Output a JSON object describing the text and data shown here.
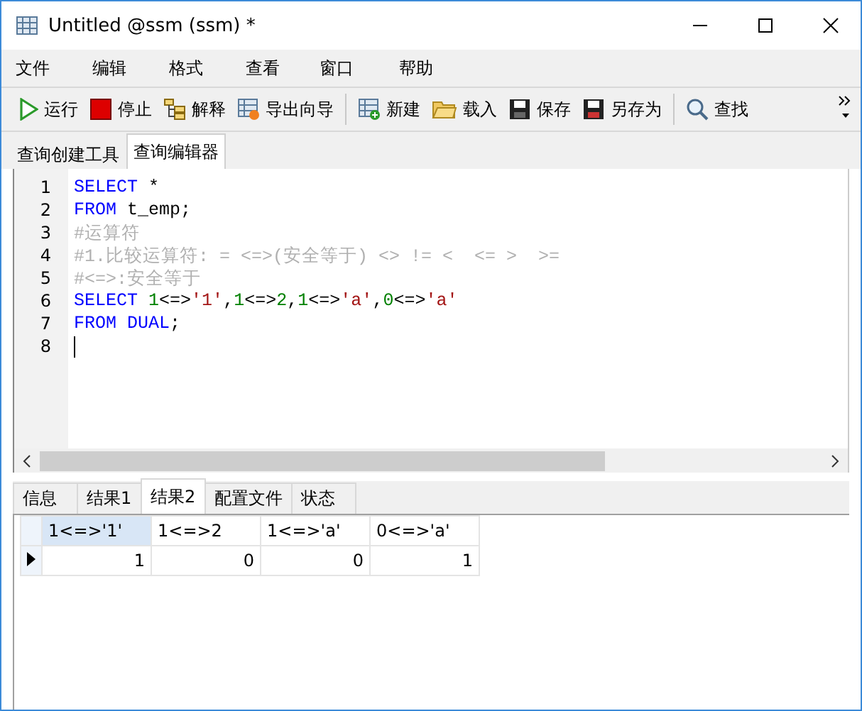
{
  "window": {
    "title": "Untitled @ssm (ssm) *"
  },
  "menu": [
    "文件",
    "编辑",
    "格式",
    "查看",
    "窗口",
    "帮助"
  ],
  "toolbar": [
    {
      "kind": "run",
      "label": "运行"
    },
    {
      "kind": "stop",
      "label": "停止"
    },
    {
      "kind": "explain",
      "label": "解释"
    },
    {
      "kind": "export",
      "label": "导出向导"
    },
    {
      "kind": "sep"
    },
    {
      "kind": "new",
      "label": "新建"
    },
    {
      "kind": "load",
      "label": "载入"
    },
    {
      "kind": "save",
      "label": "保存"
    },
    {
      "kind": "saveas",
      "label": "另存为"
    },
    {
      "kind": "sep"
    },
    {
      "kind": "find",
      "label": "查找"
    }
  ],
  "tabs": [
    {
      "label": "查询创建工具",
      "selected": false
    },
    {
      "label": "查询编辑器",
      "selected": true
    }
  ],
  "editor": {
    "lines": [
      {
        "number": "1",
        "tokens": [
          {
            "kind": "keyword",
            "text": "SELECT"
          },
          {
            "kind": "plain",
            "text": " *"
          }
        ]
      },
      {
        "number": "2",
        "tokens": [
          {
            "kind": "keyword",
            "text": "FROM"
          },
          {
            "kind": "plain",
            "text": " t_emp;"
          }
        ]
      },
      {
        "number": "3",
        "tokens": [
          {
            "kind": "comment",
            "text": "#运算符"
          }
        ]
      },
      {
        "number": "4",
        "tokens": [
          {
            "kind": "comment",
            "text": "#1.比较运算符: = <=>(安全等于) <> != <  <= >  >="
          }
        ]
      },
      {
        "number": "5",
        "tokens": [
          {
            "kind": "comment",
            "text": "#<=>:安全等于"
          }
        ]
      },
      {
        "number": "6",
        "tokens": [
          {
            "kind": "keyword",
            "text": "SELECT "
          },
          {
            "kind": "number",
            "text": "1"
          },
          {
            "kind": "plain",
            "text": "<=>"
          },
          {
            "kind": "string",
            "text": "'1'"
          },
          {
            "kind": "plain",
            "text": ","
          },
          {
            "kind": "number",
            "text": "1"
          },
          {
            "kind": "plain",
            "text": "<=>"
          },
          {
            "kind": "number",
            "text": "2"
          },
          {
            "kind": "plain",
            "text": ","
          },
          {
            "kind": "number",
            "text": "1"
          },
          {
            "kind": "plain",
            "text": "<=>"
          },
          {
            "kind": "string",
            "text": "'a'"
          },
          {
            "kind": "plain",
            "text": ","
          },
          {
            "kind": "number",
            "text": "0"
          },
          {
            "kind": "plain",
            "text": "<=>"
          },
          {
            "kind": "string",
            "text": "'a'"
          }
        ]
      },
      {
        "number": "7",
        "tokens": [
          {
            "kind": "keyword",
            "text": "FROM DUAL"
          },
          {
            "kind": "plain",
            "text": ";"
          }
        ]
      },
      {
        "number": "8",
        "cursor": true
      }
    ]
  },
  "result_tabs": [
    {
      "label": "信息",
      "selected": false
    },
    {
      "label": "结果1",
      "selected": false
    },
    {
      "label": "结果2",
      "selected": true
    },
    {
      "label": "配置文件",
      "selected": false
    },
    {
      "label": "状态",
      "selected": false
    }
  ],
  "table": {
    "columns": [
      {
        "label": "1<=>'1'",
        "selected": true
      },
      {
        "label": "1<=>2",
        "selected": false
      },
      {
        "label": "1<=>'a'",
        "selected": false
      },
      {
        "label": "0<=>'a'",
        "selected": false
      }
    ],
    "rows": [
      {
        "selected": true,
        "cells": [
          "1",
          "0",
          "0",
          "1"
        ]
      }
    ]
  }
}
